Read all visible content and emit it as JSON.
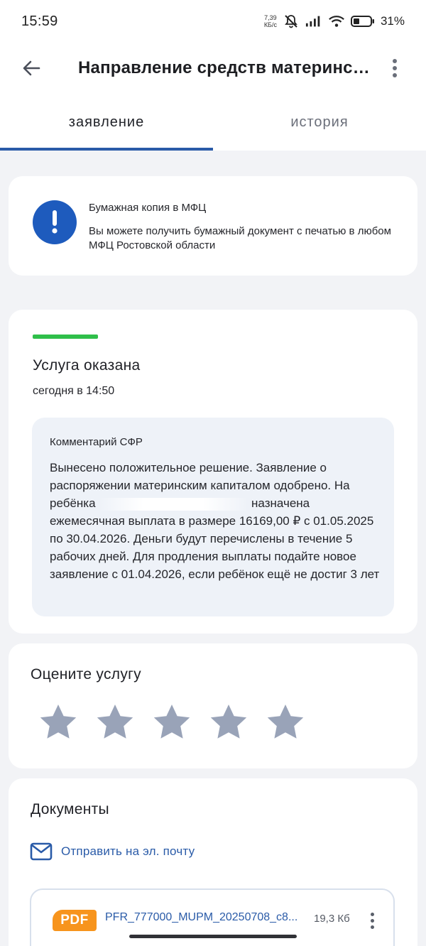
{
  "status_bar": {
    "time": "15:59",
    "net_speed_value": "7,39",
    "net_speed_unit": "КБ/с",
    "battery_pct": "31%",
    "icons": [
      "mute-icon",
      "signal-icon",
      "wifi-icon",
      "battery-icon"
    ]
  },
  "appbar": {
    "title": "Направление средств материнского капитала",
    "back_icon": "arrow-left-icon",
    "more_icon": "more-vertical-icon"
  },
  "tabs": [
    {
      "label": "заявление",
      "active": true
    },
    {
      "label": "история",
      "active": false
    }
  ],
  "info_card": {
    "icon": "exclamation-icon",
    "title": "Бумажная копия в МФЦ",
    "text": "Вы можете получить бумажный документ с печатью в любом МФЦ Ростовской области"
  },
  "status_card": {
    "status_color": "#2fbf4a",
    "title": "Услуга оказана",
    "date": "сегодня в 14:50",
    "comment_title": "Комментарий СФР",
    "comment_part1": "Вынесено положительное решение. Заявление о распоряжении материнским капиталом одобрено. На ребёнка",
    "comment_part2": "назначена ежемесячная выплата в размере 16169,00 ₽ с 01.05.2025 по 30.04.2026. Деньги будут перечислены в течение 5 рабочих дней. Для продления выплаты подайте новое заявление с 01.04.2026, если ребёнок ещё не достиг 3 лет"
  },
  "rating_card": {
    "title": "Оцените услугу",
    "stars": 5,
    "star_color": "#99a3b8"
  },
  "documents_card": {
    "title": "Документы",
    "email_label": "Отправить на эл. почту",
    "email_icon": "mail-icon",
    "file": {
      "badge": "PDF",
      "name": "PFR_777000_MUPM_20250708_c8...",
      "size": "19,3 Кб"
    }
  },
  "colors": {
    "accent": "#2a5ba8",
    "info_icon_bg": "#1e5bbd",
    "pdf_badge": "#f7941d"
  }
}
